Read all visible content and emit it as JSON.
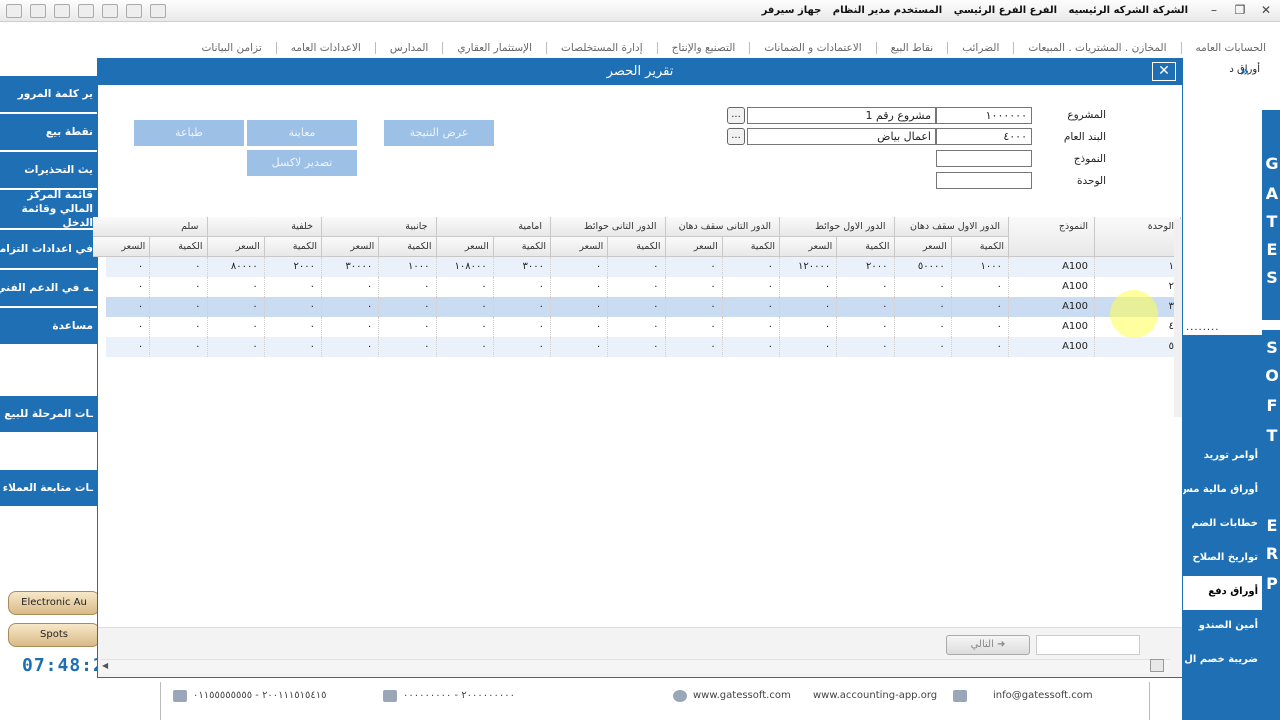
{
  "topbar": {
    "company": "الشركة الشركه الرئيسيه",
    "branch": "الفرع الفرع الرئيسي",
    "user": "المستخدم مدير النظام",
    "device": "جهاز سيرفر"
  },
  "menu": [
    "الحسابات العامه",
    "المخازن . المشتريات . المبيعات",
    "الضرائب",
    "نقاط البيع",
    "الاعتمادات و الضمانات",
    "التصنيع والإنتاج",
    "إدارة المستخلصات",
    "الإستثمار العقاري",
    "المدارس",
    "الاعدادات العامه",
    "تزامن البيانات"
  ],
  "left_sidebar": {
    "items": [
      "ير كلمة المرور",
      "نقطة بيع",
      "يث التحذيرات",
      "قائمة المركز المالي وقائمة الدخل",
      "في اعدادات التزامن",
      "ـه في الدعم الفني",
      "مساعدة",
      "ـات المرحلة للبيع",
      "ـات متابعة العملاء"
    ],
    "pills": [
      "Electronic Au",
      "Spots"
    ],
    "clock": "07:48:2"
  },
  "right_sidebar": {
    "top_item": "أوراق د",
    "letters": [
      "G",
      "A",
      "T",
      "E",
      "S",
      "S",
      "O",
      "F",
      "T",
      "E",
      "R",
      "P"
    ],
    "dots": "........",
    "items": [
      "أوامر توريد",
      "أوراق مالية مس",
      "خطابات الضم",
      "تواريخ الصلاح",
      "أوراق دفع",
      "أمين الصندو",
      "ضريبة خصم ال"
    ]
  },
  "dialog": {
    "title": "تقرير الحصر",
    "fields": {
      "project_label": "المشروع",
      "project_code": "١٠٠٠٠٠٠",
      "project_name": "مشروع رقم 1",
      "item_label": "البند العام",
      "item_code": "٤٠٠٠",
      "item_name": "اعمال بياض",
      "model_label": "النموذج",
      "unit_label": "الوحدة",
      "ellipsis": "..."
    },
    "buttons": {
      "show_result": "عرض النتيجة",
      "preview": "معاينة",
      "print": "طباعة",
      "export_excel": "تصدير لاكسل",
      "next": "التالي"
    }
  },
  "grid": {
    "col_unit": "الوحدة",
    "col_model": "النموذج",
    "groups": [
      "الدور الاول سقف دهان",
      "الدور الاول حوائط",
      "الدور التانى سقف دهان",
      "الدور التانى حوائط",
      "امامية",
      "جانبية",
      "خلفية",
      "سلم"
    ],
    "sub_qty": "الكمية",
    "sub_price": "السعر",
    "rows": [
      {
        "unit": "١",
        "model": "A100",
        "vals": [
          "١٠٠٠",
          "٥٠٠٠٠",
          "٢٠٠٠",
          "١٢٠٠٠٠",
          "٠",
          "٠",
          "٠",
          "٠",
          "٣٠٠٠",
          "١٠٨٠٠٠",
          "١٠٠٠",
          "٣٠٠٠٠",
          "٢٠٠٠",
          "٨٠٠٠٠",
          "٠",
          "٠"
        ]
      },
      {
        "unit": "٢",
        "model": "A100",
        "vals": [
          "٠",
          "٠",
          "٠",
          "٠",
          "٠",
          "٠",
          "٠",
          "٠",
          "٠",
          "٠",
          "٠",
          "٠",
          "٠",
          "٠",
          "٠",
          "٠"
        ]
      },
      {
        "unit": "٣",
        "model": "A100",
        "vals": [
          "٠",
          "٠",
          "٠",
          "٠",
          "٠",
          "٠",
          "٠",
          "٠",
          "٠",
          "٠",
          "٠",
          "٠",
          "٠",
          "٠",
          "٠",
          "٠"
        ]
      },
      {
        "unit": "٤",
        "model": "A100",
        "vals": [
          "٠",
          "٠",
          "٠",
          "٠",
          "٠",
          "٠",
          "٠",
          "٠",
          "٠",
          "٠",
          "٠",
          "٠",
          "٠",
          "٠",
          "٠",
          "٠"
        ]
      },
      {
        "unit": "٥",
        "model": "A100",
        "vals": [
          "٠",
          "٠",
          "٠",
          "٠",
          "٠",
          "٠",
          "٠",
          "٠",
          "٠",
          "٠",
          "٠",
          "٠",
          "٠",
          "٠",
          "٠",
          "٠"
        ]
      }
    ]
  },
  "footer": {
    "phone": "٢٠٠١١١٥١٥٤١٥ - ٠١١٥٥٥٥٥٥٥٥",
    "phone2": "٢٠٠٠٠٠٠٠٠٠ - ٠٠٠٠٠٠٠٠٠",
    "web1": "www.gatessoft.com",
    "web2": "www.accounting-app.org",
    "email": "info@gatessoft.com"
  },
  "colors": {
    "accent": "#1f6fb4",
    "selected_row": "#c9dcf2",
    "alt_row": "#eaf1fa",
    "disabled_button": "#9dc0e6"
  }
}
